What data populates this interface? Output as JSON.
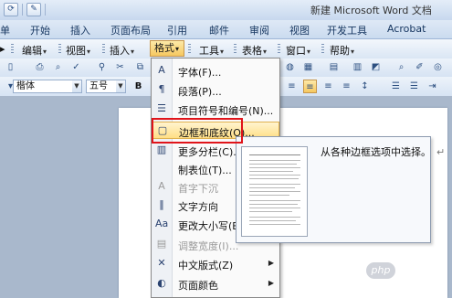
{
  "title_bar": {
    "title": "新建 Microsoft Word 文档"
  },
  "ribbon_tabs": [
    "单",
    "开始",
    "插入",
    "页面布局",
    "引用",
    "邮件",
    "审阅",
    "视图",
    "开发工具",
    "Acrobat"
  ],
  "menu_bar": {
    "items": [
      "编辑",
      "视图",
      "插入",
      "格式",
      "工具",
      "表格",
      "窗口",
      "帮助"
    ],
    "active": "格式"
  },
  "toolbar": {
    "font_name": "楷体",
    "font_size": "五号",
    "bold": "B"
  },
  "format_menu": {
    "items": [
      {
        "icon": "A",
        "label": "字体(F)...",
        "enabled": true,
        "submenu": false
      },
      {
        "icon": "¶",
        "label": "段落(P)...",
        "enabled": true,
        "submenu": false
      },
      {
        "icon": "☰",
        "label": "项目符号和编号(N)...",
        "enabled": true,
        "submenu": false
      },
      {
        "icon": "▢",
        "label": "边框和底纹(O)...",
        "enabled": true,
        "submenu": false,
        "highlighted": true
      },
      {
        "icon": "▥",
        "label": "更多分栏(C)...",
        "enabled": true,
        "submenu": false
      },
      {
        "icon": "",
        "label": "制表位(T)...",
        "enabled": true,
        "submenu": false
      },
      {
        "icon": "A",
        "label": "首字下沉",
        "enabled": false,
        "submenu": false
      },
      {
        "icon": "‖",
        "label": "文字方向",
        "enabled": true,
        "submenu": false
      },
      {
        "icon": "Aa",
        "label": "更改大小写(E)...",
        "enabled": true,
        "submenu": false
      },
      {
        "icon": "▤",
        "label": "调整宽度(I)...",
        "enabled": false,
        "submenu": false
      },
      {
        "icon": "✕",
        "label": "中文版式(Z)",
        "enabled": true,
        "submenu": true
      },
      {
        "icon": "◐",
        "label": "页面颜色",
        "enabled": true,
        "submenu": true
      }
    ]
  },
  "tooltip": {
    "text": "从各种边框选项中选择。"
  },
  "watermark": {
    "logo_text": "php",
    "site_text": "中文网"
  },
  "colors": {
    "highlight_border": "#e0141a",
    "menu_highlight": "#ffdf86",
    "ribbon_bg": "#cadbef"
  }
}
